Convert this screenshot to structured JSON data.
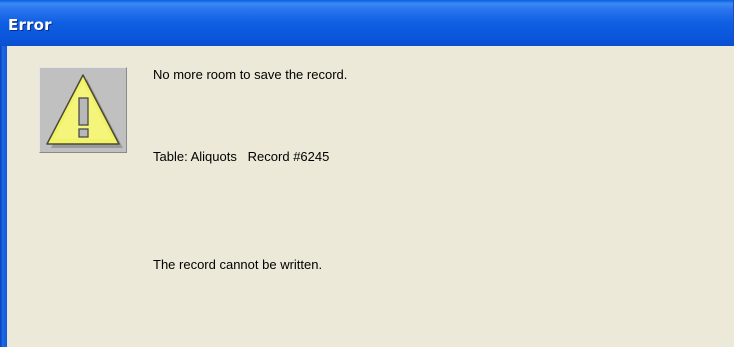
{
  "window": {
    "title": "Error"
  },
  "dialog": {
    "icon": "warning-icon",
    "message_line1": "No more room to save the record.",
    "message_line2": "Table: Aliquots   Record #6245",
    "message_line3": "The record cannot be written."
  },
  "colors": {
    "titlebar": "#0a5fe0",
    "background": "#ece9d8",
    "warning_yellow": "#f2f266"
  }
}
